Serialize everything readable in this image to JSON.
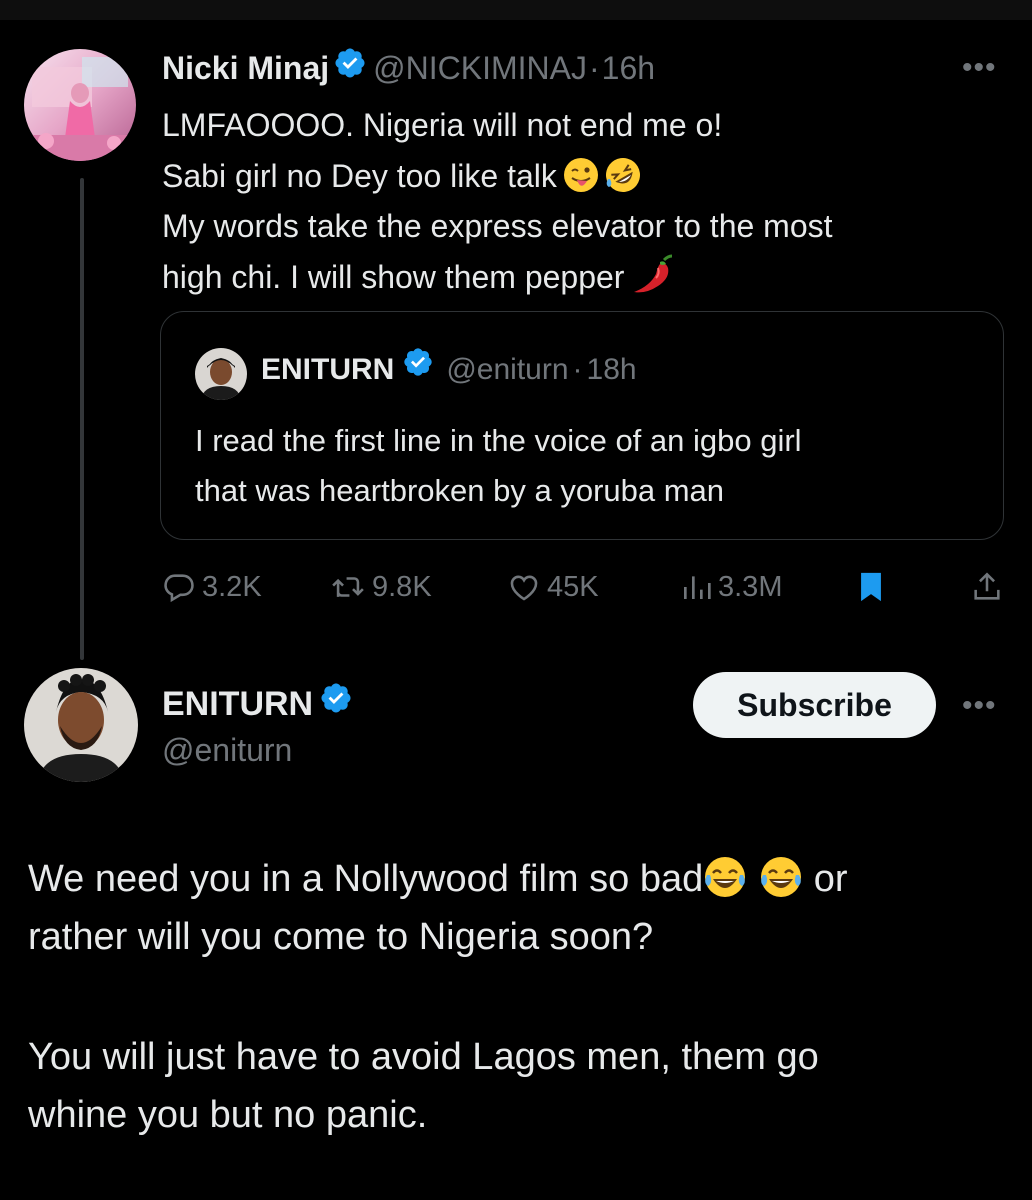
{
  "tweet1": {
    "name": "Nicki Minaj",
    "handle": "@NICKIMINAJ",
    "sep": "·",
    "time": "16h",
    "lines": [
      "LMFAOOOO. Nigeria will not end me o!",
      "Sabi girl no Dey too like talk",
      "My words take the express elevator to the most",
      "high chi. I will show them pepper"
    ],
    "emojis": [
      "tongue-out-face-icon",
      "rofl-face-icon",
      "hot-pepper-icon"
    ]
  },
  "quote": {
    "name": "ENITURN",
    "handle": "@eniturn",
    "sep": "·",
    "time": "18h",
    "lines": [
      "I read the first line in the voice of an igbo girl",
      "that was heartbroken by a yoruba man"
    ]
  },
  "actions": {
    "replies": "3.2K",
    "reposts": "9.8K",
    "likes": "45K",
    "views": "3.3M"
  },
  "tweet2": {
    "name": "ENITURN",
    "handle": "@eniturn",
    "subscribe_label": "Subscribe",
    "p1_line1_start": "We need you in a Nollywood film so bad",
    "p1_line1_end": " or",
    "p1_line2": "rather will you come to Nigeria soon?",
    "p2_line1": "You will just have to avoid Lagos men, them go",
    "p2_line2": "whine you but no panic."
  },
  "colors": {
    "background": "#000000",
    "text": "#e7e9ea",
    "muted": "#71767b",
    "verified": "#1d9bf0",
    "bookmark_active": "#1d9bf0",
    "divider": "#2f3336"
  }
}
